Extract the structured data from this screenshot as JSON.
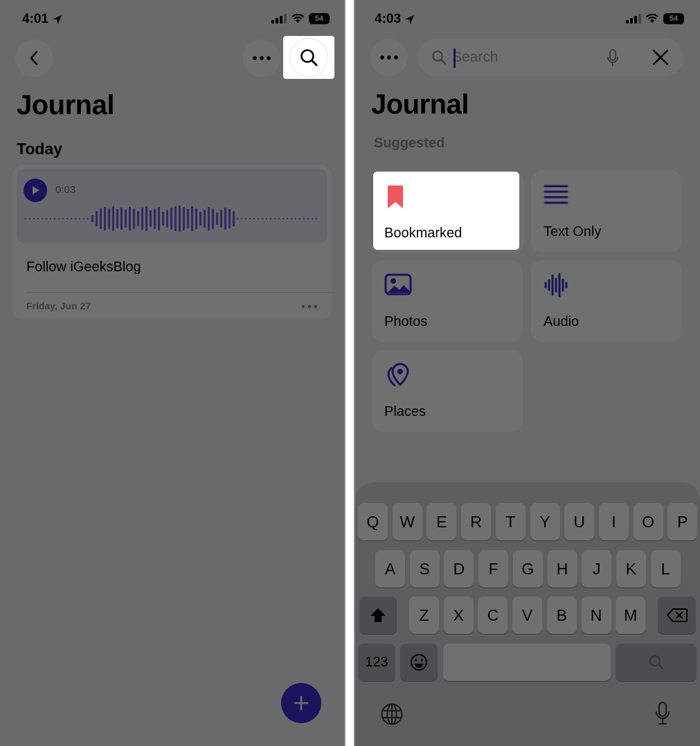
{
  "left_screen": {
    "status": {
      "time": "4:01",
      "battery": "54"
    },
    "toolbar": {
      "back_icon": "chevron-left-icon",
      "more_icon": "ellipsis-icon",
      "search_icon": "magnifier-icon"
    },
    "title": "Journal",
    "section_header": "Today",
    "entry": {
      "duration": "0:03",
      "text": "Follow iGeeksBlog",
      "date": "Friday, Jun 27",
      "more_icon": "ellipsis-icon"
    },
    "fab_icon": "plus-icon"
  },
  "right_screen": {
    "status": {
      "time": "4:03",
      "battery": "54"
    },
    "search": {
      "placeholder": "Search",
      "value": ""
    },
    "title": "Journal",
    "suggested_label": "Suggested",
    "suggestions": [
      {
        "label": "Bookmarked",
        "icon": "bookmark-icon",
        "color": "#f0565e"
      },
      {
        "label": "Text Only",
        "icon": "text-lines-icon",
        "color": "#3a2fd0"
      },
      {
        "label": "Photos",
        "icon": "photo-icon",
        "color": "#3a2fd0"
      },
      {
        "label": "Audio",
        "icon": "waveform-icon",
        "color": "#3a2fd0"
      },
      {
        "label": "Places",
        "icon": "map-pin-icon",
        "color": "#3a2fd0"
      }
    ],
    "keyboard": {
      "row1": [
        "Q",
        "W",
        "E",
        "R",
        "T",
        "Y",
        "U",
        "I",
        "O",
        "P"
      ],
      "row2": [
        "A",
        "S",
        "D",
        "F",
        "G",
        "H",
        "J",
        "K",
        "L"
      ],
      "row3": [
        "Z",
        "X",
        "C",
        "V",
        "B",
        "N",
        "M"
      ],
      "numbers_key": "123",
      "space_key": "",
      "search_key": ""
    }
  },
  "colors": {
    "accent": "#3a2fd0",
    "bookmark": "#f0565e",
    "background": "#f2f2f7",
    "keyboard": "#d3d5db"
  }
}
